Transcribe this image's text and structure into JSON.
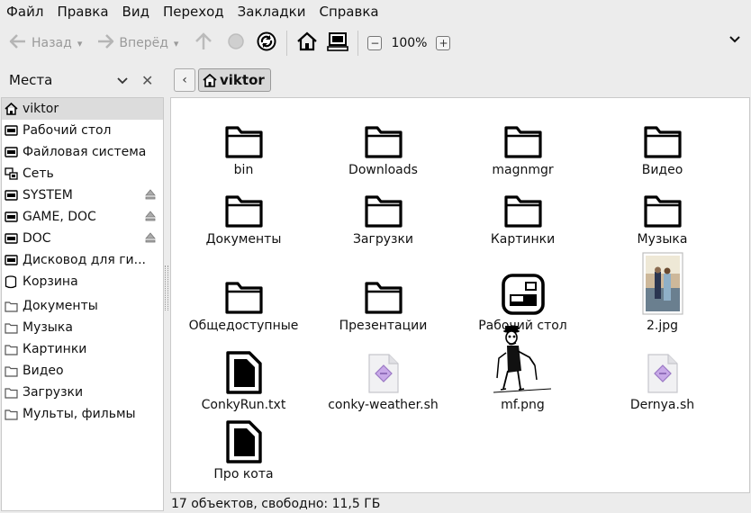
{
  "menubar": [
    "Файл",
    "Правка",
    "Вид",
    "Переход",
    "Закладки",
    "Справка"
  ],
  "toolbar": {
    "back_label": "Назад",
    "forward_label": "Вперёд",
    "zoom": "100%",
    "icons": [
      "back-arrow-icon",
      "forward-arrow-icon",
      "up-icon",
      "stop-icon",
      "reload-icon",
      "home-icon",
      "computer-icon",
      "zoom-out-icon",
      "zoom-in-icon",
      "menu-chevron-icon"
    ]
  },
  "sidebar": {
    "title": "Места",
    "items": [
      {
        "label": "viktor",
        "icon": "home"
      },
      {
        "label": "Рабочий стол",
        "icon": "drive"
      },
      {
        "label": "Файловая система",
        "icon": "drive"
      },
      {
        "label": "Сеть",
        "icon": "network"
      },
      {
        "label": "SYSTEM",
        "icon": "drive",
        "eject": true
      },
      {
        "label": "GAME, DOC",
        "icon": "drive",
        "eject": true
      },
      {
        "label": "DOC",
        "icon": "drive",
        "eject": true
      },
      {
        "label": "Дисковод для ги...",
        "icon": "drive"
      },
      {
        "label": "Корзина",
        "icon": "trash"
      },
      {
        "label": "Документы",
        "icon": "folder"
      },
      {
        "label": "Музыка",
        "icon": "folder"
      },
      {
        "label": "Картинки",
        "icon": "folder"
      },
      {
        "label": "Видео",
        "icon": "folder"
      },
      {
        "label": "Загрузки",
        "icon": "folder"
      },
      {
        "label": "Мульты, фильмы",
        "icon": "folder"
      }
    ]
  },
  "path": {
    "current": "viktor"
  },
  "files": [
    {
      "name": "bin",
      "type": "folder"
    },
    {
      "name": "Downloads",
      "type": "folder"
    },
    {
      "name": "magnmgr",
      "type": "folder"
    },
    {
      "name": "Видео",
      "type": "folder"
    },
    {
      "name": "Документы",
      "type": "folder"
    },
    {
      "name": "Загрузки",
      "type": "folder"
    },
    {
      "name": "Картинки",
      "type": "folder"
    },
    {
      "name": "Музыка",
      "type": "folder"
    },
    {
      "name": "Общедоступные",
      "type": "folder"
    },
    {
      "name": "Презентации",
      "type": "folder"
    },
    {
      "name": "Рабочий стол",
      "type": "desktop"
    },
    {
      "name": "2.jpg",
      "type": "photo"
    },
    {
      "name": "ConkyRun.txt",
      "type": "document"
    },
    {
      "name": "conky-weather.sh",
      "type": "script"
    },
    {
      "name": "mf.png",
      "type": "sketch"
    },
    {
      "name": "Dernya.sh",
      "type": "script"
    },
    {
      "name": "Про кота",
      "type": "document"
    }
  ],
  "status": "17 объектов, свободно: 11,5 ГБ"
}
